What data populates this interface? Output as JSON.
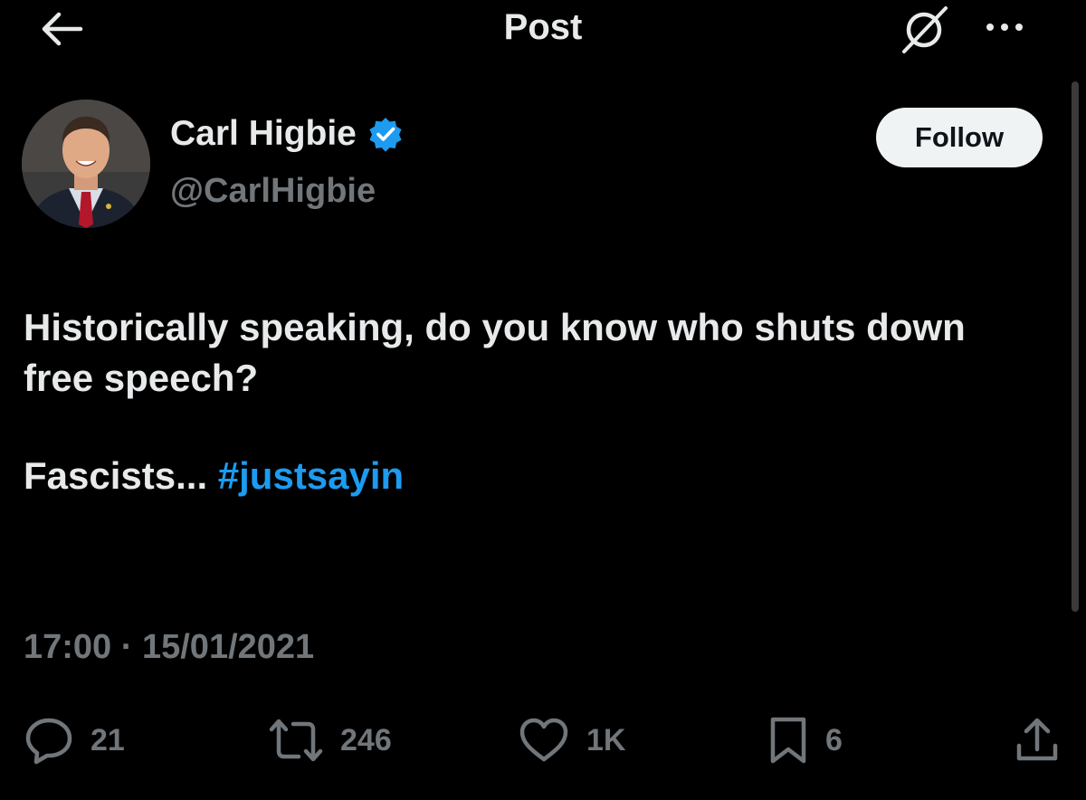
{
  "header": {
    "title": "Post",
    "back_icon": "arrow-left-icon",
    "grok_icon": "grok-slash-icon",
    "more_icon": "more-horizontal-icon"
  },
  "author": {
    "name": "Carl Higbie",
    "handle": "@CarlHigbie",
    "verified": true,
    "verified_color": "#1d9bf0",
    "follow_label": "Follow"
  },
  "post": {
    "paragraphs": [
      "Historically speaking, do you know who shuts down free speech?",
      "Fascists..."
    ],
    "hashtag": "#justsayin",
    "time": "17:00",
    "separator": "·",
    "date": "15/01/2021"
  },
  "actions": {
    "replies": "21",
    "reposts": "246",
    "likes": "1K",
    "bookmarks": "6",
    "icons": [
      "reply-icon",
      "repost-icon",
      "like-icon",
      "bookmark-icon",
      "share-icon"
    ]
  },
  "colors": {
    "background": "#000000",
    "text": "#e7e9ea",
    "muted": "#71767b",
    "accent": "#1d9bf0"
  }
}
